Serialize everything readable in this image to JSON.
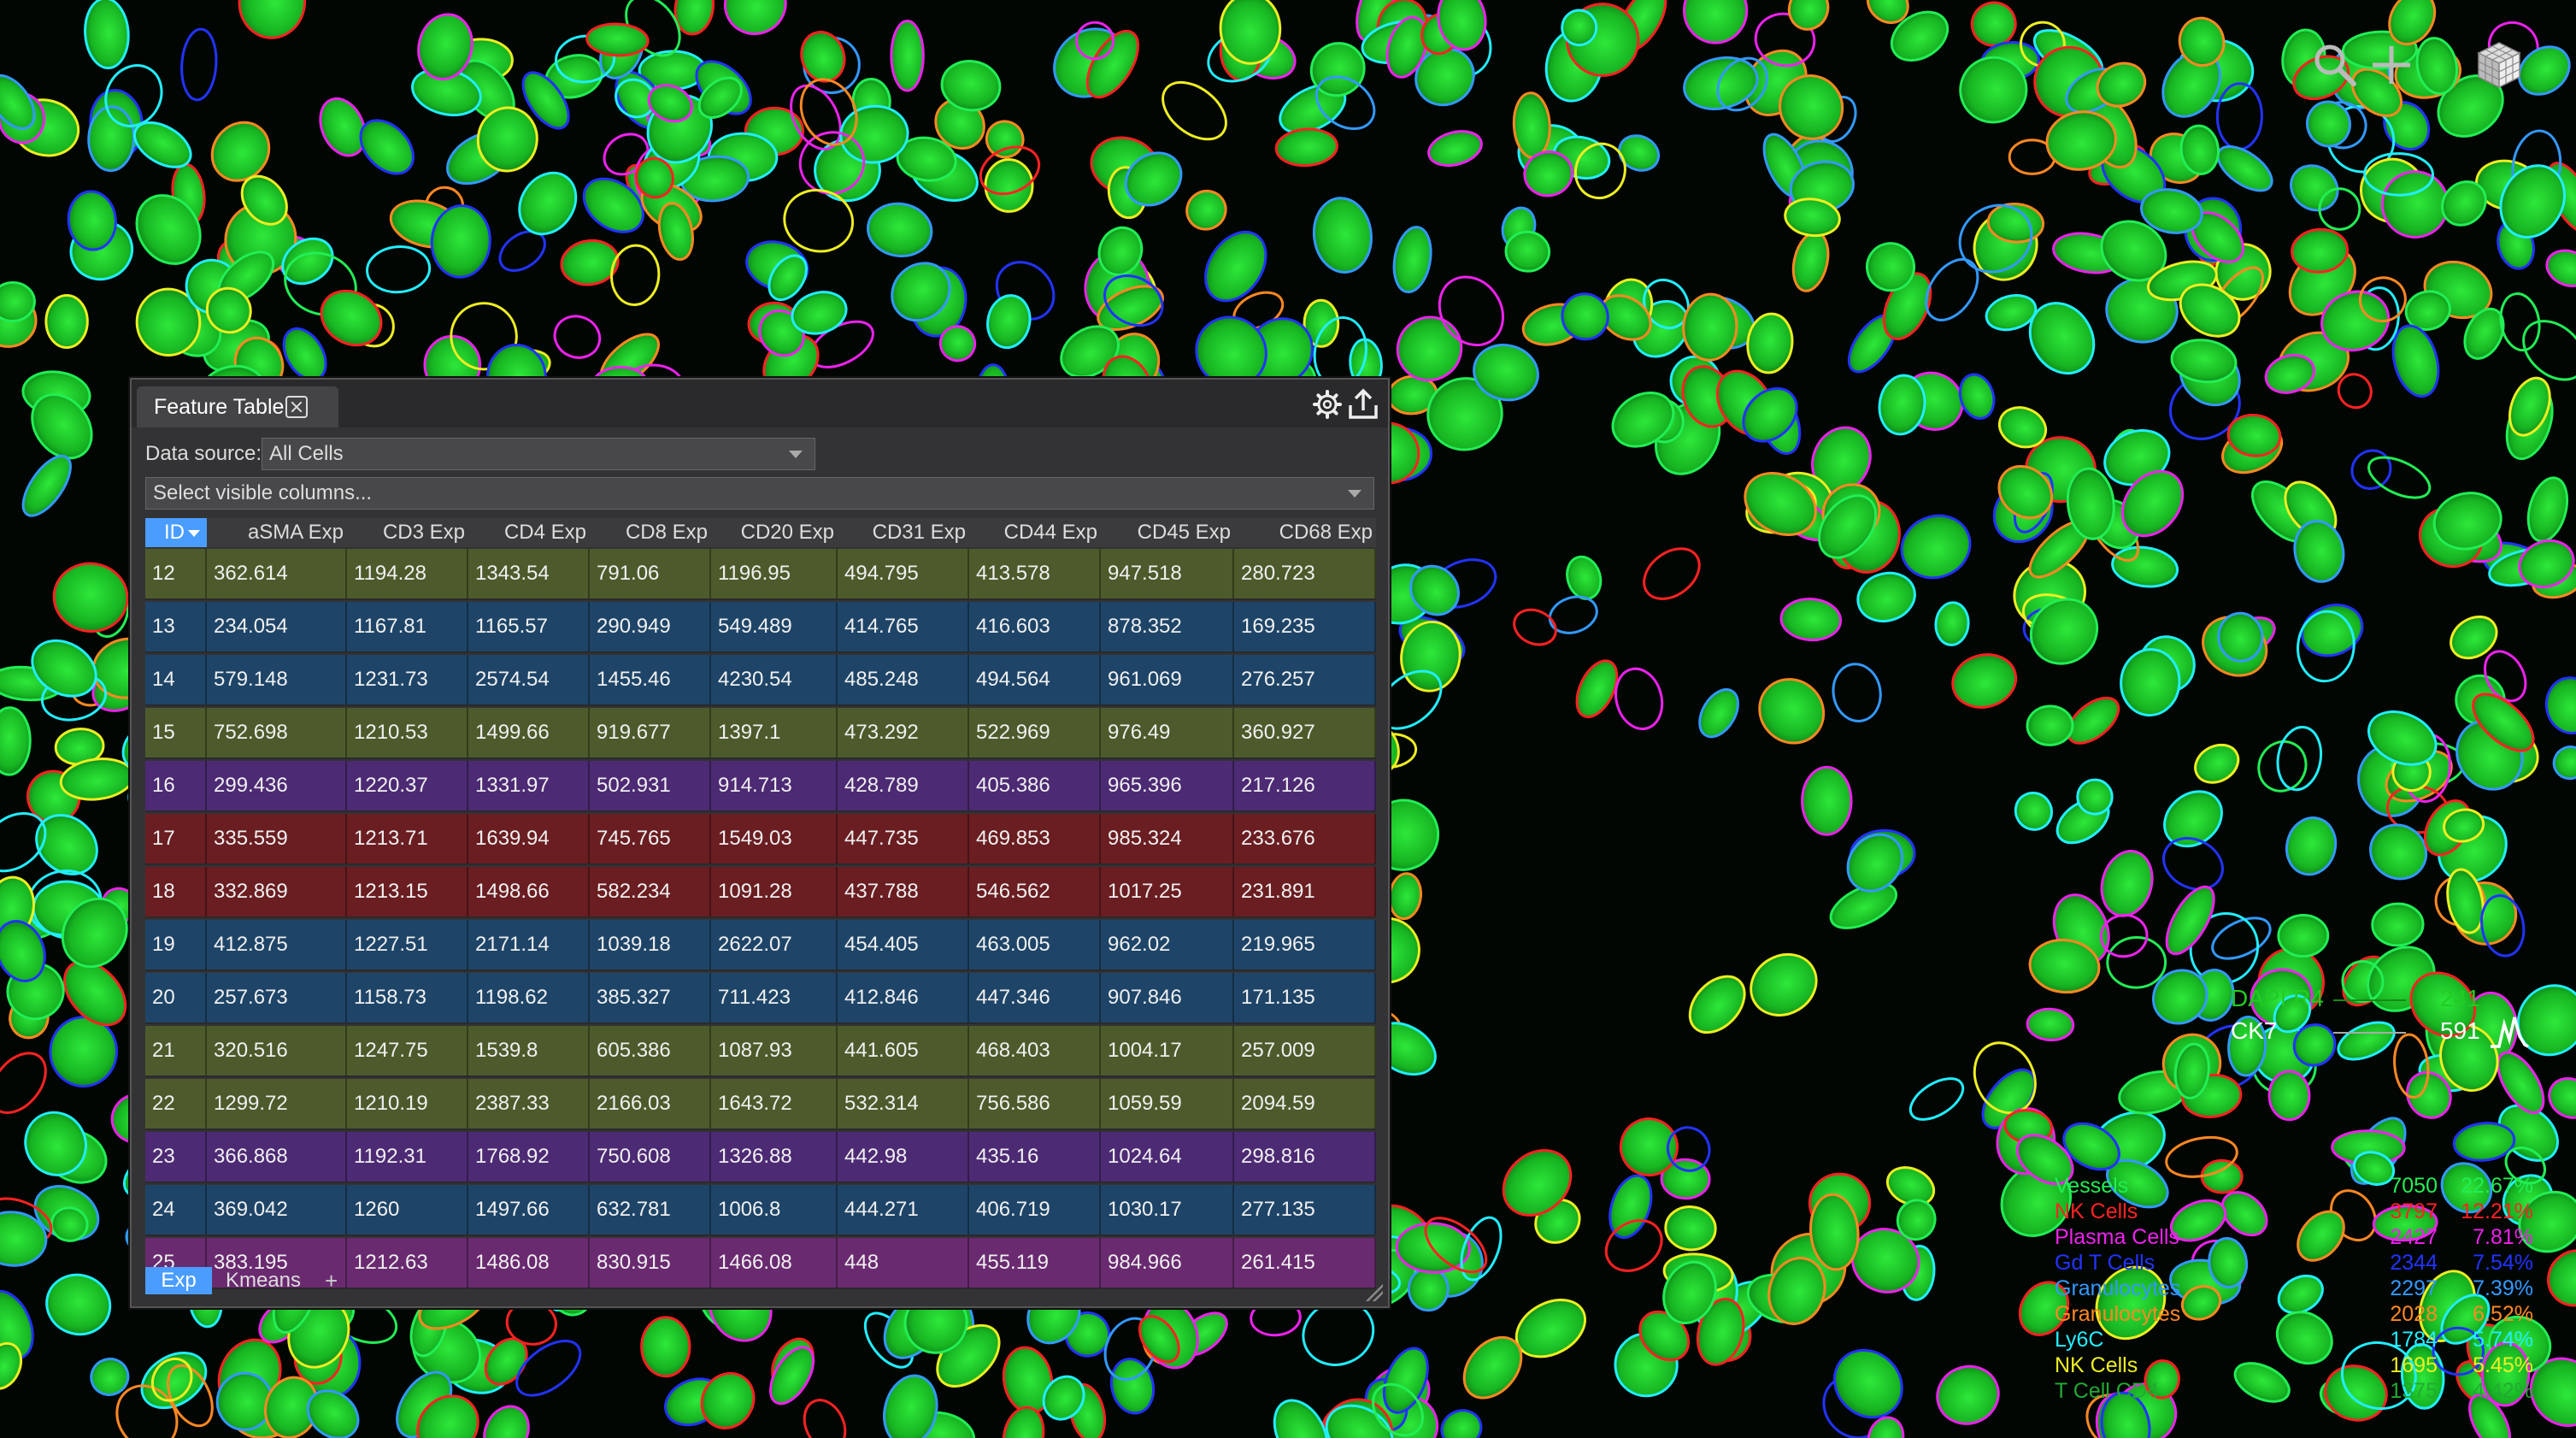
{
  "panel": {
    "tab_title": "Feature Table",
    "data_source_label": "Data source:",
    "data_source_value": "All Cells",
    "columns_placeholder": "Select visible columns...",
    "columns": [
      "ID",
      "aSMA Exp",
      "CD3 Exp",
      "CD4 Exp",
      "CD8 Exp",
      "CD20 Exp",
      "CD31 Exp",
      "CD44 Exp",
      "CD45 Exp",
      "CD68 Exp"
    ],
    "rows": [
      {
        "color": "olive",
        "cells": [
          "12",
          "362.614",
          "1194.28",
          "1343.54",
          "791.06",
          "1196.95",
          "494.795",
          "413.578",
          "947.518",
          "280.723"
        ]
      },
      {
        "color": "navy",
        "cells": [
          "13",
          "234.054",
          "1167.81",
          "1165.57",
          "290.949",
          "549.489",
          "414.765",
          "416.603",
          "878.352",
          "169.235"
        ]
      },
      {
        "color": "navy",
        "cells": [
          "14",
          "579.148",
          "1231.73",
          "2574.54",
          "1455.46",
          "4230.54",
          "485.248",
          "494.564",
          "961.069",
          "276.257"
        ]
      },
      {
        "color": "olive",
        "cells": [
          "15",
          "752.698",
          "1210.53",
          "1499.66",
          "919.677",
          "1397.1",
          "473.292",
          "522.969",
          "976.49",
          "360.927"
        ]
      },
      {
        "color": "purple",
        "cells": [
          "16",
          "299.436",
          "1220.37",
          "1331.97",
          "502.931",
          "914.713",
          "428.789",
          "405.386",
          "965.396",
          "217.126"
        ]
      },
      {
        "color": "red",
        "cells": [
          "17",
          "335.559",
          "1213.71",
          "1639.94",
          "745.765",
          "1549.03",
          "447.735",
          "469.853",
          "985.324",
          "233.676"
        ]
      },
      {
        "color": "red",
        "cells": [
          "18",
          "332.869",
          "1213.15",
          "1498.66",
          "582.234",
          "1091.28",
          "437.788",
          "546.562",
          "1017.25",
          "231.891"
        ]
      },
      {
        "color": "navy",
        "cells": [
          "19",
          "412.875",
          "1227.51",
          "2171.14",
          "1039.18",
          "2622.07",
          "454.405",
          "463.005",
          "962.02",
          "219.965"
        ]
      },
      {
        "color": "navy",
        "cells": [
          "20",
          "257.673",
          "1158.73",
          "1198.62",
          "385.327",
          "711.423",
          "412.846",
          "447.346",
          "907.846",
          "171.135"
        ]
      },
      {
        "color": "olive",
        "cells": [
          "21",
          "320.516",
          "1247.75",
          "1539.8",
          "605.386",
          "1087.93",
          "441.605",
          "468.403",
          "1004.17",
          "257.009"
        ]
      },
      {
        "color": "olive",
        "cells": [
          "22",
          "1299.72",
          "1210.19",
          "2387.33",
          "2166.03",
          "1643.72",
          "532.314",
          "756.586",
          "1059.59",
          "2094.59"
        ]
      },
      {
        "color": "purple",
        "cells": [
          "23",
          "366.868",
          "1192.31",
          "1768.92",
          "750.608",
          "1326.88",
          "442.98",
          "435.16",
          "1024.64",
          "298.816"
        ]
      },
      {
        "color": "navy",
        "cells": [
          "24",
          "369.042",
          "1260",
          "1497.66",
          "632.781",
          "1006.8",
          "444.271",
          "406.719",
          "1030.17",
          "277.135"
        ]
      },
      {
        "color": "magenta",
        "cells": [
          "25",
          "383.195",
          "1212.63",
          "1486.08",
          "830.915",
          "1466.08",
          "448",
          "455.119",
          "984.966",
          "261.415"
        ]
      }
    ],
    "bottom_tabs": [
      "Exp",
      "Kmeans"
    ],
    "add_tab": "+",
    "row_colors": {
      "olive": "#4d5b2c",
      "navy": "#1e4568",
      "purple": "#4d2a74",
      "red": "#6a1e22",
      "magenta": "#6a2a70"
    }
  },
  "channels": [
    {
      "name": "DAPI R4",
      "value": "241",
      "color": "#22cc22"
    },
    {
      "name": "CK7",
      "value": "591",
      "color": "#ffffff"
    }
  ],
  "classes": [
    {
      "name": "Vessels",
      "count": "7050",
      "pct": "22.67%",
      "color": "#22ee55"
    },
    {
      "name": "NK Cells",
      "count": "3797",
      "pct": "12.21%",
      "color": "#ff2222"
    },
    {
      "name": "Plasma Cells",
      "count": "2427",
      "pct": "7.81%",
      "color": "#ee22ee"
    },
    {
      "name": "Gd T Cells",
      "count": "2344",
      "pct": "7.54%",
      "color": "#2233ff"
    },
    {
      "name": "Granulocytes",
      "count": "2297",
      "pct": "7.39%",
      "color": "#3399ff"
    },
    {
      "name": "Granulocytes",
      "count": "2028",
      "pct": "6.52%",
      "color": "#ff8822"
    },
    {
      "name": "Ly6C",
      "count": "1784",
      "pct": "5.74%",
      "color": "#22eeff"
    },
    {
      "name": "NK Cells",
      "count": "1695",
      "pct": "5.45%",
      "color": "#eeee22"
    },
    {
      "name": "T Cell CD4",
      "count": "1375",
      "pct": "4.42%",
      "color": "#22aa33"
    }
  ],
  "colors": {
    "nucleus_fill": "#1ecc2a",
    "outlines": [
      "#22eeff",
      "#3399ff",
      "#ee22ee",
      "#ff2222",
      "#eeee22",
      "#ff8822",
      "#2233ff",
      "#22ee55"
    ]
  }
}
